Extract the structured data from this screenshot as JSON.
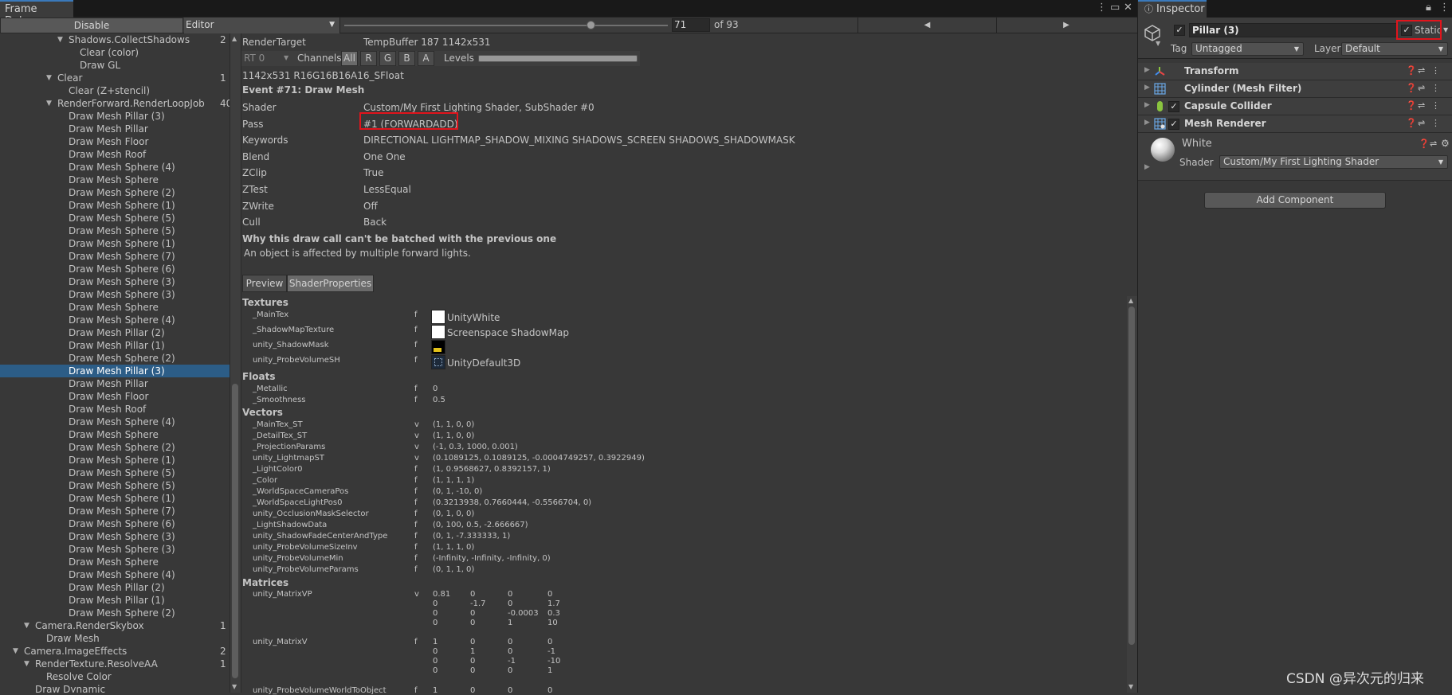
{
  "frame_debugger": {
    "tab_title": "Frame Debug",
    "disable_label": "Disable",
    "target_dropdown": "Editor",
    "current_event": "71",
    "event_total": "of 93",
    "slider_fraction": 0.763,
    "tree": [
      {
        "label": "Shadows.CollectShadows",
        "indent": 86,
        "fold": "open",
        "count": "2"
      },
      {
        "label": "Clear (color)",
        "indent": 100,
        "fold": "",
        "count": ""
      },
      {
        "label": "Draw GL",
        "indent": 100,
        "fold": "",
        "count": ""
      },
      {
        "label": "Clear",
        "indent": 72,
        "fold": "open",
        "count": "1"
      },
      {
        "label": "Clear (Z+stencil)",
        "indent": 86,
        "fold": "",
        "count": ""
      },
      {
        "label": "RenderForward.RenderLoopJob",
        "indent": 72,
        "fold": "open",
        "count": "40"
      },
      {
        "label": "Draw Mesh Pillar (3)",
        "indent": 86,
        "fold": "",
        "count": ""
      },
      {
        "label": "Draw Mesh Pillar",
        "indent": 86,
        "fold": "",
        "count": ""
      },
      {
        "label": "Draw Mesh Floor",
        "indent": 86,
        "fold": "",
        "count": ""
      },
      {
        "label": "Draw Mesh Roof",
        "indent": 86,
        "fold": "",
        "count": ""
      },
      {
        "label": "Draw Mesh Sphere (4)",
        "indent": 86,
        "fold": "",
        "count": ""
      },
      {
        "label": "Draw Mesh Sphere",
        "indent": 86,
        "fold": "",
        "count": ""
      },
      {
        "label": "Draw Mesh Sphere (2)",
        "indent": 86,
        "fold": "",
        "count": ""
      },
      {
        "label": "Draw Mesh Sphere (1)",
        "indent": 86,
        "fold": "",
        "count": ""
      },
      {
        "label": "Draw Mesh Sphere (5)",
        "indent": 86,
        "fold": "",
        "count": ""
      },
      {
        "label": "Draw Mesh Sphere (5)",
        "indent": 86,
        "fold": "",
        "count": ""
      },
      {
        "label": "Draw Mesh Sphere (1)",
        "indent": 86,
        "fold": "",
        "count": ""
      },
      {
        "label": "Draw Mesh Sphere (7)",
        "indent": 86,
        "fold": "",
        "count": ""
      },
      {
        "label": "Draw Mesh Sphere (6)",
        "indent": 86,
        "fold": "",
        "count": ""
      },
      {
        "label": "Draw Mesh Sphere (3)",
        "indent": 86,
        "fold": "",
        "count": ""
      },
      {
        "label": "Draw Mesh Sphere (3)",
        "indent": 86,
        "fold": "",
        "count": ""
      },
      {
        "label": "Draw Mesh Sphere",
        "indent": 86,
        "fold": "",
        "count": ""
      },
      {
        "label": "Draw Mesh Sphere (4)",
        "indent": 86,
        "fold": "",
        "count": ""
      },
      {
        "label": "Draw Mesh Pillar (2)",
        "indent": 86,
        "fold": "",
        "count": ""
      },
      {
        "label": "Draw Mesh Pillar (1)",
        "indent": 86,
        "fold": "",
        "count": ""
      },
      {
        "label": "Draw Mesh Sphere (2)",
        "indent": 86,
        "fold": "",
        "count": ""
      },
      {
        "label": "Draw Mesh Pillar (3)",
        "indent": 86,
        "fold": "",
        "count": "",
        "selected": true
      },
      {
        "label": "Draw Mesh Pillar",
        "indent": 86,
        "fold": "",
        "count": ""
      },
      {
        "label": "Draw Mesh Floor",
        "indent": 86,
        "fold": "",
        "count": ""
      },
      {
        "label": "Draw Mesh Roof",
        "indent": 86,
        "fold": "",
        "count": ""
      },
      {
        "label": "Draw Mesh Sphere (4)",
        "indent": 86,
        "fold": "",
        "count": ""
      },
      {
        "label": "Draw Mesh Sphere",
        "indent": 86,
        "fold": "",
        "count": ""
      },
      {
        "label": "Draw Mesh Sphere (2)",
        "indent": 86,
        "fold": "",
        "count": ""
      },
      {
        "label": "Draw Mesh Sphere (1)",
        "indent": 86,
        "fold": "",
        "count": ""
      },
      {
        "label": "Draw Mesh Sphere (5)",
        "indent": 86,
        "fold": "",
        "count": ""
      },
      {
        "label": "Draw Mesh Sphere (5)",
        "indent": 86,
        "fold": "",
        "count": ""
      },
      {
        "label": "Draw Mesh Sphere (1)",
        "indent": 86,
        "fold": "",
        "count": ""
      },
      {
        "label": "Draw Mesh Sphere (7)",
        "indent": 86,
        "fold": "",
        "count": ""
      },
      {
        "label": "Draw Mesh Sphere (6)",
        "indent": 86,
        "fold": "",
        "count": ""
      },
      {
        "label": "Draw Mesh Sphere (3)",
        "indent": 86,
        "fold": "",
        "count": ""
      },
      {
        "label": "Draw Mesh Sphere (3)",
        "indent": 86,
        "fold": "",
        "count": ""
      },
      {
        "label": "Draw Mesh Sphere",
        "indent": 86,
        "fold": "",
        "count": ""
      },
      {
        "label": "Draw Mesh Sphere (4)",
        "indent": 86,
        "fold": "",
        "count": ""
      },
      {
        "label": "Draw Mesh Pillar (2)",
        "indent": 86,
        "fold": "",
        "count": ""
      },
      {
        "label": "Draw Mesh Pillar (1)",
        "indent": 86,
        "fold": "",
        "count": ""
      },
      {
        "label": "Draw Mesh Sphere (2)",
        "indent": 86,
        "fold": "",
        "count": ""
      },
      {
        "label": "Camera.RenderSkybox",
        "indent": 44,
        "fold": "open",
        "count": "1"
      },
      {
        "label": "Draw Mesh",
        "indent": 58,
        "fold": "",
        "count": ""
      },
      {
        "label": "Camera.ImageEffects",
        "indent": 30,
        "fold": "open",
        "count": "2"
      },
      {
        "label": "RenderTexture.ResolveAA",
        "indent": 44,
        "fold": "open",
        "count": "1"
      },
      {
        "label": "Resolve Color",
        "indent": 58,
        "fold": "",
        "count": ""
      },
      {
        "label": "Draw Dynamic",
        "indent": 44,
        "fold": "",
        "count": ""
      }
    ],
    "render_target_label": "RenderTarget",
    "render_target_value": "TempBuffer 187 1142x531",
    "rt_dropdown": "RT 0",
    "channels_label": "Channels",
    "channels": [
      "All",
      "R",
      "G",
      "B",
      "A"
    ],
    "levels_label": "Levels",
    "format": "1142x531 R16G16B16A16_SFloat",
    "event_title": "Event #71: Draw Mesh",
    "props": [
      {
        "label": "Shader",
        "value": "Custom/My First Lighting Shader, SubShader #0"
      },
      {
        "label": "Pass",
        "value": "#1 (FORWARDADD)"
      },
      {
        "label": "Keywords",
        "value": "DIRECTIONAL LIGHTMAP_SHADOW_MIXING SHADOWS_SCREEN SHADOWS_SHADOWMASK"
      },
      {
        "label": "Blend",
        "value": "One One"
      },
      {
        "label": "ZClip",
        "value": "True"
      },
      {
        "label": "ZTest",
        "value": "LessEqual"
      },
      {
        "label": "ZWrite",
        "value": "Off"
      },
      {
        "label": "Cull",
        "value": "Back"
      }
    ],
    "batch_title": "Why this draw call can't be batched with the previous one",
    "batch_reason": "An object is affected by multiple forward lights.",
    "tabs": [
      "Preview",
      "ShaderProperties"
    ],
    "textures_title": "Textures",
    "textures": [
      {
        "name": "_MainTex",
        "flag": "f",
        "value": "UnityWhite",
        "swatch": "white"
      },
      {
        "name": "_ShadowMapTexture",
        "flag": "f",
        "value": "Screenspace ShadowMap",
        "swatch": "white"
      },
      {
        "name": "unity_ShadowMask",
        "flag": "f",
        "value": "",
        "swatch": "shadowmask"
      },
      {
        "name": "unity_ProbeVolumeSH",
        "flag": "f",
        "value": "UnityDefault3D",
        "swatch": "grid"
      }
    ],
    "floats_title": "Floats",
    "floats": [
      {
        "name": "_Metallic",
        "flag": "f",
        "value": "0"
      },
      {
        "name": "_Smoothness",
        "flag": "f",
        "value": "0.5"
      }
    ],
    "vectors_title": "Vectors",
    "vectors": [
      {
        "name": "_MainTex_ST",
        "flag": "v",
        "value": "(1, 1, 0, 0)"
      },
      {
        "name": "_DetailTex_ST",
        "flag": "v",
        "value": "(1, 1, 0, 0)"
      },
      {
        "name": "_ProjectionParams",
        "flag": "v",
        "value": "(-1, 0.3, 1000, 0.001)"
      },
      {
        "name": "unity_LightmapST",
        "flag": "v",
        "value": "(0.1089125, 0.1089125, -0.0004749257, 0.3922949)"
      },
      {
        "name": "_LightColor0",
        "flag": "f",
        "value": "(1, 0.9568627, 0.8392157, 1)"
      },
      {
        "name": "_Color",
        "flag": "f",
        "value": "(1, 1, 1, 1)"
      },
      {
        "name": "_WorldSpaceCameraPos",
        "flag": "f",
        "value": "(0, 1, -10, 0)"
      },
      {
        "name": "_WorldSpaceLightPos0",
        "flag": "f",
        "value": "(0.3213938, 0.7660444, -0.5566704, 0)"
      },
      {
        "name": "unity_OcclusionMaskSelector",
        "flag": "f",
        "value": "(0, 1, 0, 0)"
      },
      {
        "name": "_LightShadowData",
        "flag": "f",
        "value": "(0, 100, 0.5, -2.666667)"
      },
      {
        "name": "unity_ShadowFadeCenterAndType",
        "flag": "f",
        "value": "(0, 1, -7.333333, 1)"
      },
      {
        "name": "unity_ProbeVolumeSizeInv",
        "flag": "f",
        "value": "(1, 1, 1, 0)"
      },
      {
        "name": "unity_ProbeVolumeMin",
        "flag": "f",
        "value": "(-Infinity, -Infinity, -Infinity, 0)"
      },
      {
        "name": "unity_ProbeVolumeParams",
        "flag": "f",
        "value": "(0, 1, 1, 0)"
      }
    ],
    "matrices_title": "Matrices",
    "matrices": [
      {
        "name": "unity_MatrixVP",
        "flag": "v",
        "rows": [
          [
            "0.81",
            "0",
            "0",
            "0"
          ],
          [
            "0",
            "-1.7",
            "0",
            "1.7"
          ],
          [
            "0",
            "0",
            "-0.0003",
            "0.3"
          ],
          [
            "0",
            "0",
            "1",
            "10"
          ]
        ]
      },
      {
        "name": "unity_MatrixV",
        "flag": "f",
        "rows": [
          [
            "1",
            "0",
            "0",
            "0"
          ],
          [
            "0",
            "1",
            "0",
            "-1"
          ],
          [
            "0",
            "0",
            "-1",
            "-10"
          ],
          [
            "0",
            "0",
            "0",
            "1"
          ]
        ]
      },
      {
        "name": "unity_ProbeVolumeWorldToObject",
        "flag": "f",
        "rows": [
          [
            "1",
            "0",
            "0",
            "0"
          ]
        ]
      }
    ]
  },
  "inspector": {
    "tab_title": "Inspector",
    "object_name": "Pillar (3)",
    "static_label": "Static",
    "tag_label": "Tag",
    "tag_value": "Untagged",
    "layer_label": "Layer",
    "layer_value": "Default",
    "components": [
      {
        "name": "Transform",
        "checkbox": false,
        "icon": "transform-icon"
      },
      {
        "name": "Cylinder (Mesh Filter)",
        "checkbox": false,
        "icon": "mesh-filter-icon"
      },
      {
        "name": "Capsule Collider",
        "checkbox": true,
        "icon": "capsule-collider-icon"
      },
      {
        "name": "Mesh Renderer",
        "checkbox": true,
        "icon": "mesh-renderer-icon"
      }
    ],
    "material_name": "White",
    "shader_label": "Shader",
    "shader_value": "Custom/My First Lighting Shader",
    "add_component_label": "Add Component"
  },
  "watermark": "CSDN @异次元的归来",
  "colors": {
    "selection": "#2c5d87",
    "highlight_box": "#e1141c",
    "tab_accent": "#3a79bb"
  }
}
